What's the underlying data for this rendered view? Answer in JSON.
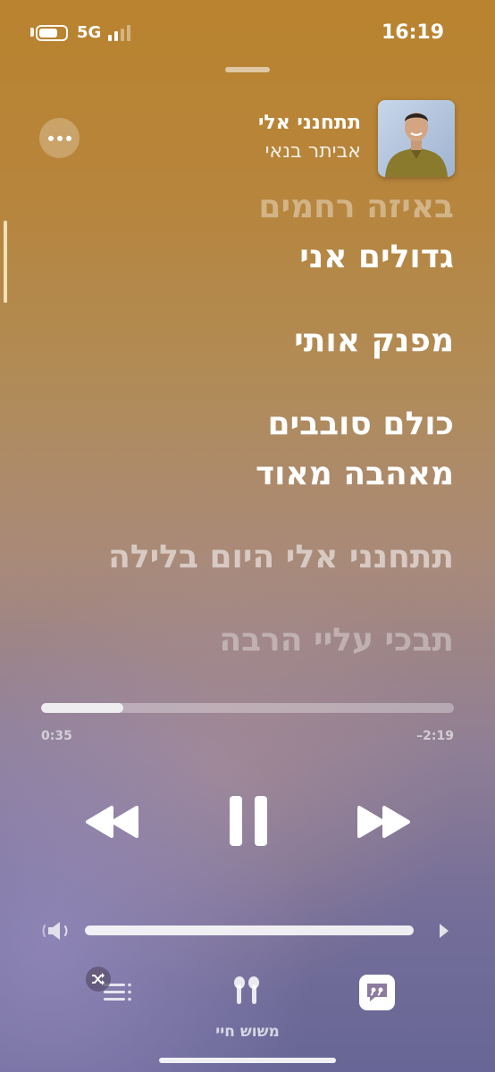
{
  "status_bar": {
    "network": "5G",
    "time": "16:19",
    "battery_level": 0.75,
    "signal_bars_active": 2
  },
  "now_playing": {
    "title": "תתחנני אלי",
    "artist": "אביתר בנאי"
  },
  "lyrics": [
    {
      "text": "באיזה רחמים",
      "state": "past"
    },
    {
      "text": "גדולים אני",
      "state": "active"
    },
    {
      "text": "מפנק אותי",
      "state": "active"
    },
    {
      "text": "כולם סובבים",
      "state": "active"
    },
    {
      "text": "מאהבה מאוד",
      "state": "active"
    },
    {
      "text": "תתחנני אלי היום בלילה",
      "state": "upcoming"
    },
    {
      "text": "תבכי עליי הרבה",
      "state": "upcoming"
    }
  ],
  "playback": {
    "elapsed": "0:35",
    "remaining": "–2:19",
    "progress": 0.2,
    "volume": 1.0
  },
  "controls": {
    "airplay_device": "משוש חיי"
  },
  "icons": {
    "more": "more-icon",
    "rewind": "rewind-icon",
    "pause": "pause-icon",
    "forward": "fast-forward-icon",
    "volume_low": "speaker-low-icon",
    "volume_high": "speaker-high-icon",
    "queue": "queue-list-icon",
    "shuffle": "shuffle-icon",
    "airplay": "airpods-icon",
    "lyrics": "lyrics-quote-icon"
  },
  "colors": {
    "bg_top": "#b9832f",
    "bg_bottom": "#686696",
    "text": "#ffffff"
  }
}
